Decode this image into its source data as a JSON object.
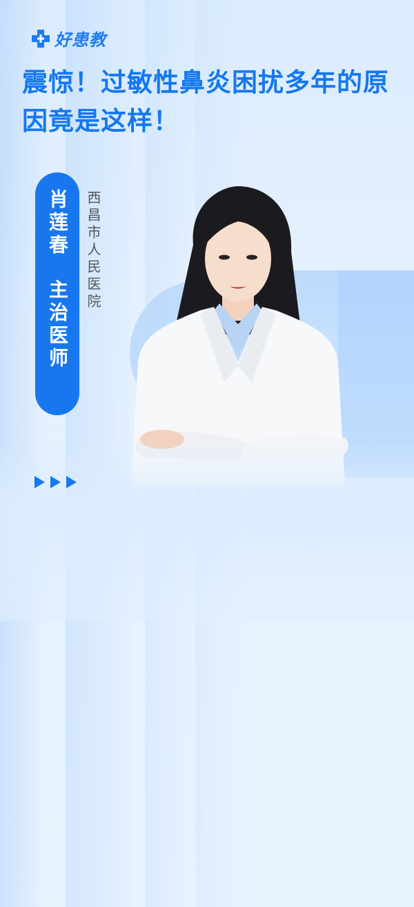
{
  "brand": {
    "logo_text": "好患教",
    "logo_icon": "medical-cross-icon",
    "color": "#1f7cf0"
  },
  "title": "震惊！过敏性鼻炎困扰多年的原因竟是这样！",
  "doctor": {
    "name": "肖莲春",
    "title": "主治医师",
    "hospital": "西昌市人民医院"
  },
  "decor": {
    "arrow_icon": "play-triangle-icon",
    "accent_color": "#1877ee"
  }
}
